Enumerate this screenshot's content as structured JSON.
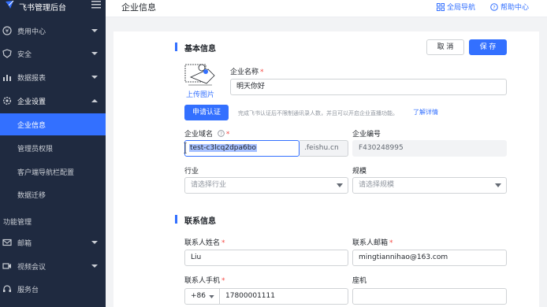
{
  "sidebar": {
    "brand": "飞书管理后台",
    "items": [
      {
        "label": "费用中心",
        "icon": "coin-icon"
      },
      {
        "label": "安全",
        "icon": "shield-icon"
      },
      {
        "label": "数据报表",
        "icon": "chart-icon"
      },
      {
        "label": "企业设置",
        "icon": "gear-icon"
      }
    ],
    "sub_items": [
      {
        "label": "企业信息",
        "active": true
      },
      {
        "label": "管理员权限"
      },
      {
        "label": "客户端导航栏配置"
      },
      {
        "label": "数据迁移"
      }
    ],
    "group_label": "功能管理",
    "items2": [
      {
        "label": "邮箱",
        "icon": "mail-icon"
      },
      {
        "label": "视频会议",
        "icon": "video-icon"
      },
      {
        "label": "服务台",
        "icon": "headset-icon"
      }
    ]
  },
  "header": {
    "title": "企业信息",
    "global_nav": "全局导航",
    "help": "帮助中心"
  },
  "basic": {
    "section_title": "基本信息",
    "cancel": "取 消",
    "save": "保 存",
    "company_name_label": "企业名称",
    "company_name_value": "明天你好",
    "upload_link": "上传图片",
    "certify_button": "申请认证",
    "certify_hint": "完成飞书认证后不限制通讯录人数，并且可以开启企业直播功能。",
    "learn_more": "了解详情",
    "domain_label": "企业域名",
    "domain_value": "test-c3lcq2dpa6bo",
    "domain_suffix": ".feishu.cn",
    "company_id_label": "企业编号",
    "company_id_value": "F430248995",
    "industry_label": "行业",
    "industry_placeholder": "请选择行业",
    "scale_label": "规模",
    "scale_placeholder": "请选择规模"
  },
  "contact": {
    "section_title": "联系信息",
    "name_label": "联系人姓名",
    "name_value": "Liu",
    "email_label": "联系人邮箱",
    "email_value": "mingtiannihao@163.com",
    "phone_label": "联系人手机",
    "phone_prefix": "+86",
    "phone_value": "17800001111",
    "landline_label": "座机"
  },
  "colors": {
    "accent": "#3370ff",
    "sidebar_bg": "#1f2a40",
    "required": "#f54a45"
  }
}
